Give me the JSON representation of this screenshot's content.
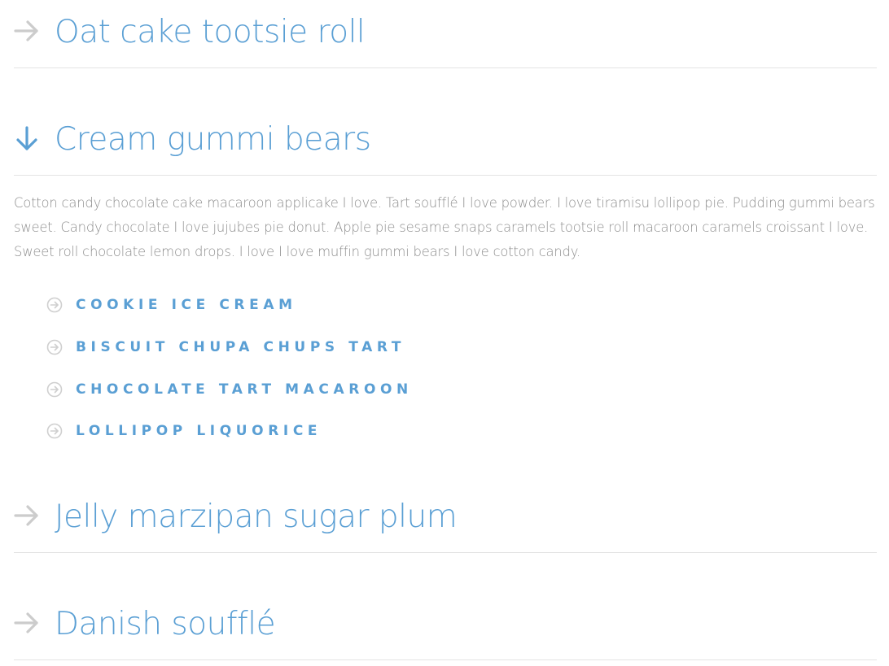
{
  "colors": {
    "accent": "#5a9fd4",
    "arrow_collapsed": "#cccccc",
    "arrow_expanded": "#5a9fd4",
    "divider": "#e3e3e3",
    "body_text": "#8e8e8e",
    "circle_icon": "#cfcfcf"
  },
  "accordion": {
    "sections": [
      {
        "title": "Oat cake tootsie roll",
        "expanded": false,
        "arrow_icon": "arrow-right-icon"
      },
      {
        "title": "Cream gummi bears",
        "expanded": true,
        "arrow_icon": "arrow-down-icon",
        "body": "Cotton candy chocolate cake macaroon applicake I love. Tart soufflé I love powder. I love tiramisu lollipop pie. Pudding gummi bears sweet. Candy chocolate I love jujubes pie donut. Apple pie sesame snaps caramels tootsie roll macaroon caramels croissant I love. Sweet roll chocolate lemon drops. I love I love muffin gummi bears I love cotton candy.",
        "links": [
          {
            "label": "Cookie ice cream",
            "icon": "circle-arrow-right-icon"
          },
          {
            "label": "Biscuit chupa chups tart",
            "icon": "circle-arrow-right-icon"
          },
          {
            "label": "Chocolate tart macaroon",
            "icon": "circle-arrow-right-icon"
          },
          {
            "label": "Lollipop liquorice",
            "icon": "circle-arrow-right-icon"
          }
        ]
      },
      {
        "title": "Jelly marzipan sugar plum",
        "expanded": false,
        "arrow_icon": "arrow-right-icon"
      },
      {
        "title": "Danish soufflé",
        "expanded": false,
        "arrow_icon": "arrow-right-icon"
      }
    ]
  }
}
